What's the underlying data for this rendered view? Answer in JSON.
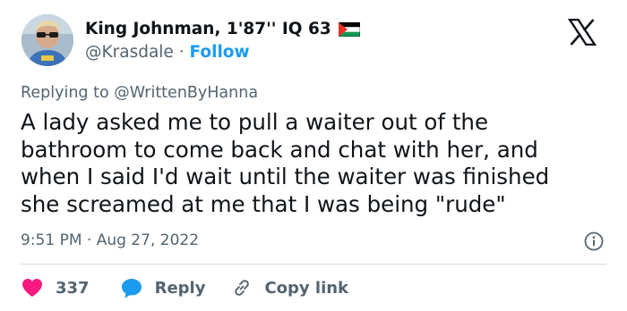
{
  "author": {
    "display_name": "King Johnman, 1'87'' IQ 63",
    "handle": "@Krasdale",
    "separator": "·",
    "follow_label": "Follow",
    "flag_icon": "palestine-flag-icon"
  },
  "reply_context": {
    "prefix": "Replying to",
    "mention": "@WrittenByHanna"
  },
  "tweet": {
    "lines": [
      "A lady asked me to pull a waiter out of the",
      "bathroom to come back and chat with her, and",
      "when I said I'd wait until the waiter was finished",
      "she screamed at me that I was being \"rude\""
    ],
    "timestamp": "9:51 PM · Aug 27, 2022"
  },
  "actions": {
    "like_count": "337",
    "reply_label": "Reply",
    "copy_label": "Copy link"
  },
  "colors": {
    "accent": "#1d9bf0",
    "like": "#f91880",
    "secondary_text": "#536471",
    "primary_text": "#0f1419",
    "divider": "#cfd9de"
  }
}
